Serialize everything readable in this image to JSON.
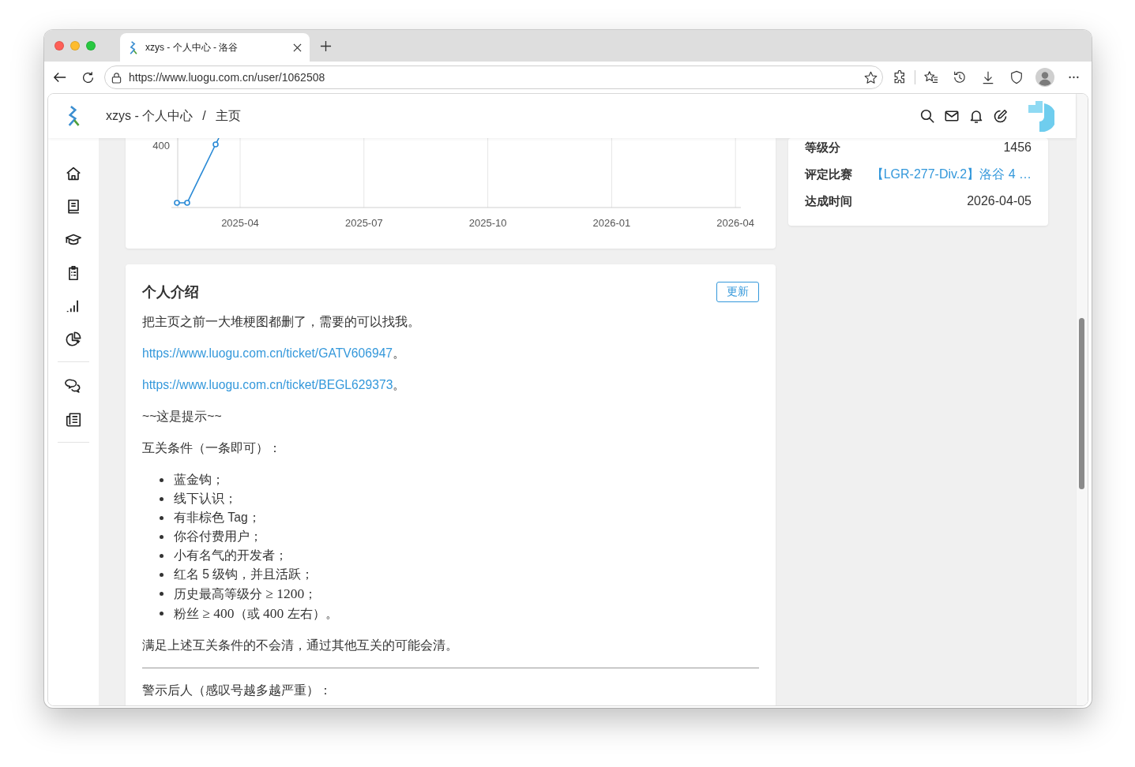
{
  "browser": {
    "tabs": [
      {
        "title": "xzys - 个人中心 - 洛谷",
        "selected": true
      }
    ],
    "address": "https://www.luogu.com.cn/user/1062508"
  },
  "header": {
    "breadcrumb": [
      "xzys - 个人中心",
      "主页"
    ],
    "separator": "/"
  },
  "rating_chart": {
    "y_tick_labels": [
      "400"
    ],
    "x_tick_labels": [
      "2025-04",
      "2025-07",
      "2025-10",
      "2026-01",
      "2026-04"
    ]
  },
  "rating_card": {
    "rows": [
      {
        "label": "等级分",
        "value": "1456",
        "kind": "text"
      },
      {
        "label": "评定比赛",
        "value": "【LGR-277-Div.2】洛谷 4 …",
        "kind": "link"
      },
      {
        "label": "达成时间",
        "value": "2026-04-05",
        "kind": "text"
      }
    ]
  },
  "intro": {
    "title": "个人介绍",
    "button": "更新",
    "blocks": [
      {
        "kind": "paragraph",
        "text": "把主页之前一大堆梗图都删了，需要的可以找我。"
      },
      {
        "kind": "link",
        "link": "https://www.luogu.com.cn/ticket/GATV606947",
        "after": "。"
      },
      {
        "kind": "link",
        "link": "https://www.luogu.com.cn/ticket/BEGL629373",
        "after": "。"
      },
      {
        "kind": "paragraph",
        "text": "~~这是提示~~"
      },
      {
        "kind": "paragraph",
        "text": "互关条件（一条即可）："
      },
      {
        "kind": "list",
        "items": [
          {
            "parts": [
              {
                "kind": "text",
                "text": "蓝金钩；"
              }
            ]
          },
          {
            "parts": [
              {
                "kind": "text",
                "text": "线下认识；"
              }
            ]
          },
          {
            "parts": [
              {
                "kind": "text",
                "text": "有非棕色 Tag；"
              }
            ]
          },
          {
            "parts": [
              {
                "kind": "text",
                "text": "你谷付费用户；"
              }
            ]
          },
          {
            "parts": [
              {
                "kind": "text",
                "text": "小有名气的开发者；"
              }
            ]
          },
          {
            "parts": [
              {
                "kind": "text",
                "text": "红名 5 级钩，并且活跃；"
              }
            ]
          },
          {
            "parts": [
              {
                "kind": "text",
                "text": "历史最高等级分 "
              },
              {
                "kind": "math",
                "text": "≥ 1200"
              },
              {
                "kind": "text",
                "text": "；"
              }
            ]
          },
          {
            "parts": [
              {
                "kind": "text",
                "text": "粉丝 "
              },
              {
                "kind": "math",
                "text": "≥ 400"
              },
              {
                "kind": "text",
                "text": "（或 "
              },
              {
                "kind": "math",
                "text": "400"
              },
              {
                "kind": "text",
                "text": " 左右）。"
              }
            ]
          }
        ]
      },
      {
        "kind": "paragraph",
        "text": "满足上述互关条件的不会清，通过其他互关的可能会清。"
      },
      {
        "kind": "rule"
      },
      {
        "kind": "paragraph",
        "text": "警示后人（感叹号越多越严重）："
      }
    ]
  }
}
